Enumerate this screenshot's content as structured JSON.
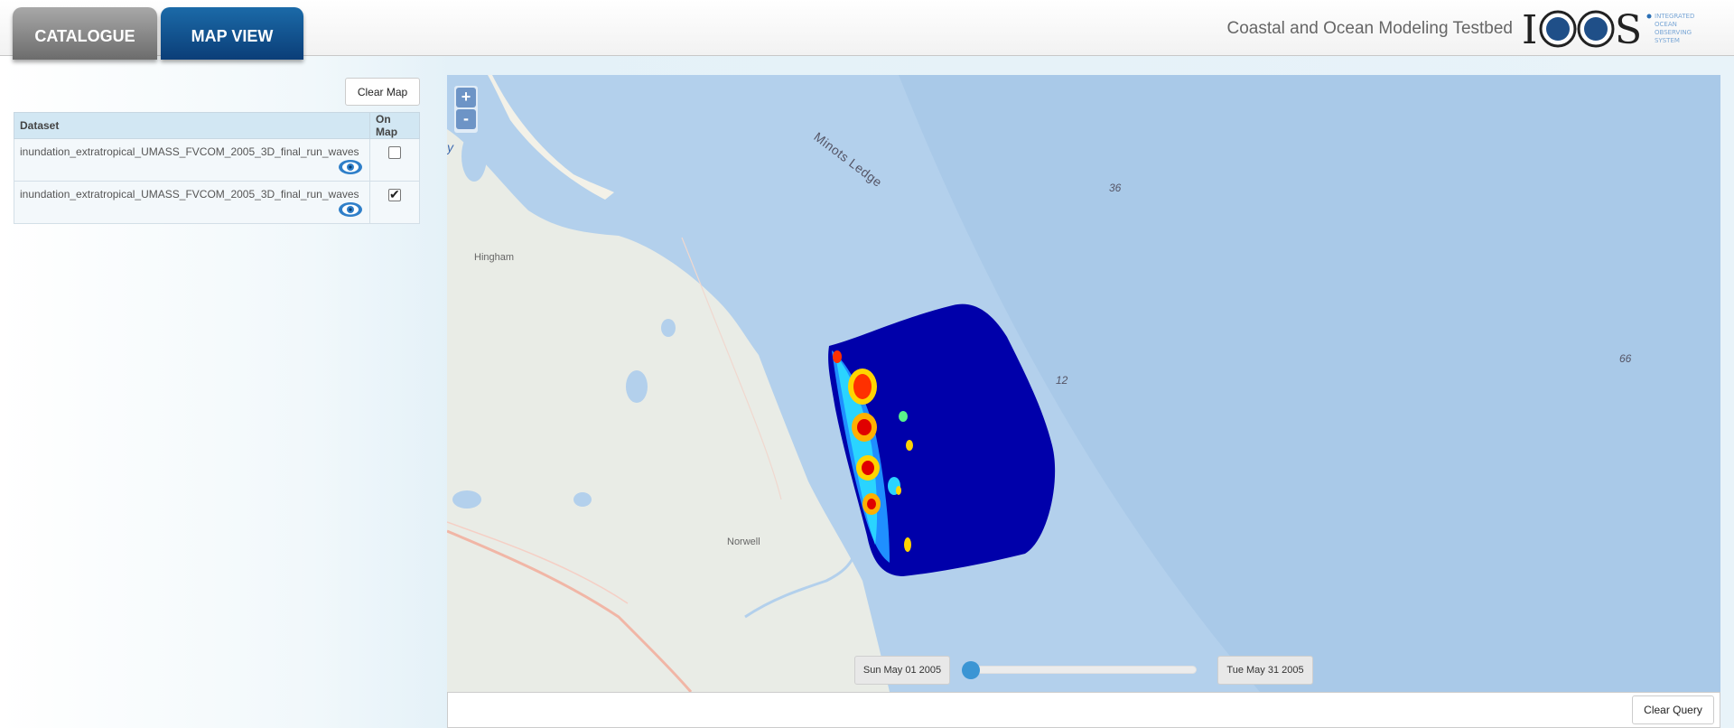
{
  "tabs": [
    {
      "label": "CATALOGUE",
      "active": false
    },
    {
      "label": "MAP VIEW",
      "active": true
    }
  ],
  "header": {
    "title": "Coastal and Ocean Modeling Testbed",
    "logo_text": "IOOS",
    "logo_tagline": [
      "INTEGRATED",
      "OCEAN",
      "OBSERVING",
      "SYSTEM"
    ]
  },
  "panel": {
    "clear_map_label": "Clear Map",
    "columns": [
      "Dataset",
      "On Map"
    ],
    "rows": [
      {
        "name": "inundation_extratropical_UMASS_FVCOM_2005_3D_final_run_waves",
        "on_map": false
      },
      {
        "name": "inundation_extratropical_UMASS_FVCOM_2005_3D_final_run_waves",
        "on_map": true
      }
    ]
  },
  "map": {
    "zoom_in": "+",
    "zoom_out": "-",
    "places": [
      "Hingham",
      "Norwell",
      "Minots Ledge"
    ],
    "depths": [
      "36",
      "12",
      "66"
    ],
    "edge_letter": "y"
  },
  "time_slider": {
    "start_label": "Sun May 01 2005",
    "end_label": "Tue May 31 2005",
    "position": 0
  },
  "footer": {
    "clear_query_label": "Clear Query"
  },
  "colors": {
    "tab_active": "#0b3e78",
    "tab_inactive": "#7a7a7a",
    "water": "#b3d0ec",
    "land": "#e9ece6",
    "model_low": "#0000aa",
    "slider": "#3b95d4"
  }
}
